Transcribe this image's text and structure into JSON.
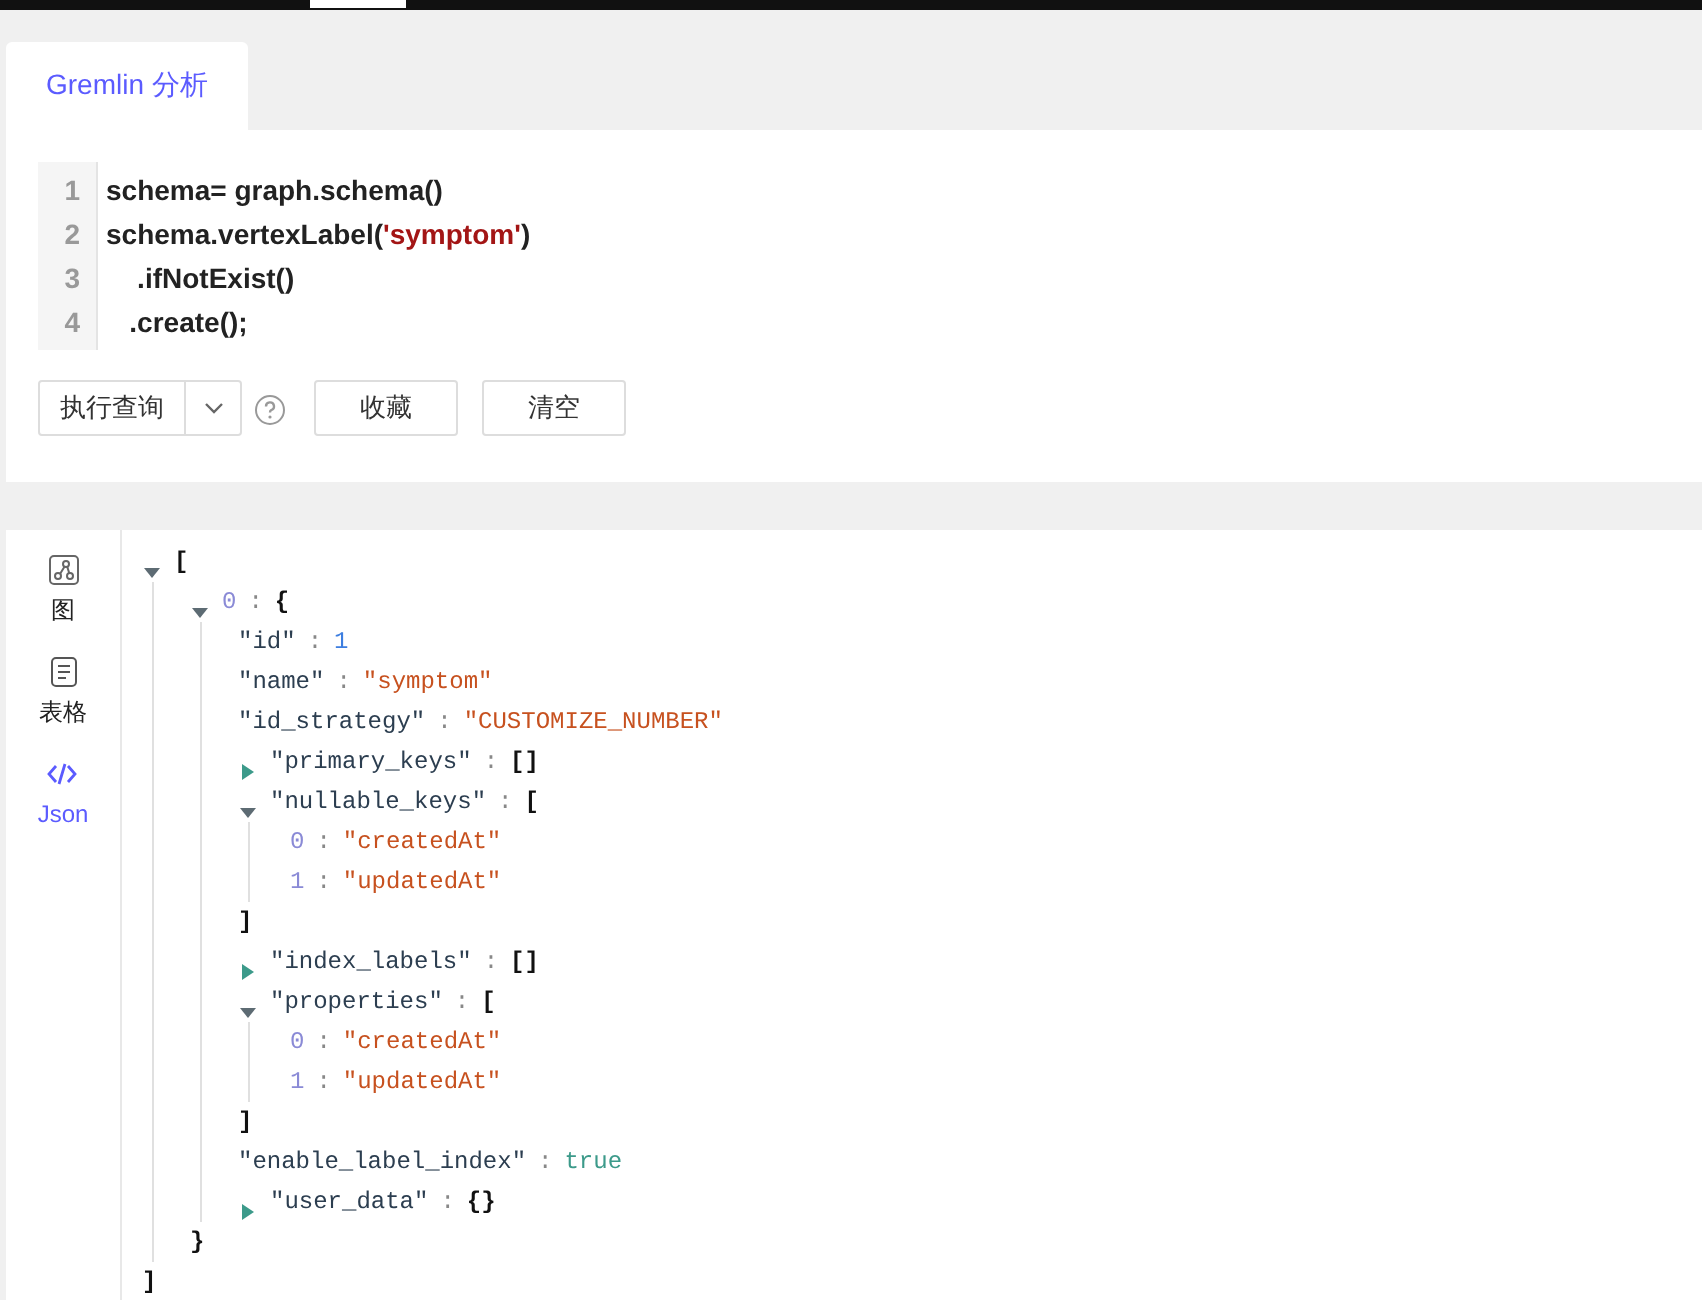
{
  "tabs": [
    {
      "label": "Gremlin 分析",
      "selected": true
    }
  ],
  "editor": {
    "lines": [
      {
        "number": "1",
        "tokens": [
          {
            "kind": "plain",
            "text": "schema= graph.schema()"
          }
        ]
      },
      {
        "number": "2",
        "tokens": [
          {
            "kind": "plain",
            "text": "schema.vertexLabel("
          },
          {
            "kind": "string",
            "text": "'symptom'"
          },
          {
            "kind": "plain",
            "text": ")"
          }
        ]
      },
      {
        "number": "3",
        "tokens": [
          {
            "kind": "plain",
            "text": "    .ifNotExist()"
          }
        ]
      },
      {
        "number": "4",
        "tokens": [
          {
            "kind": "plain",
            "text": "   .create();"
          }
        ]
      }
    ]
  },
  "actions": {
    "run_button": "执行查询",
    "buttons": [
      "收藏",
      "清空"
    ]
  },
  "sidebar": {
    "items": [
      {
        "kind": "graph",
        "label": "图",
        "selected": false
      },
      {
        "kind": "table",
        "label": "表格",
        "selected": false
      },
      {
        "kind": "code",
        "label": "Json",
        "selected": true
      }
    ]
  },
  "json_view": {
    "kind": "array",
    "open": "[",
    "close": "]",
    "expanded": true,
    "children": [
      {
        "kind": "object",
        "key": "0",
        "sep": ":",
        "open": "{",
        "close": "}",
        "expanded": true,
        "children": [
          {
            "kind": "number",
            "key": "\"id\"",
            "sep": ":",
            "value": "1"
          },
          {
            "kind": "string",
            "key": "\"name\"",
            "sep": ":",
            "value": "\"symptom\""
          },
          {
            "kind": "string",
            "key": "\"id_strategy\"",
            "sep": ":",
            "value": "\"CUSTOMIZE_NUMBER\""
          },
          {
            "kind": "array",
            "key": "\"primary_keys\"",
            "sep": ":",
            "value": "[]",
            "expanded": false
          },
          {
            "kind": "array",
            "key": "\"nullable_keys\"",
            "sep": ":",
            "open": "[",
            "close": "]",
            "expanded": true,
            "children": [
              {
                "kind": "string",
                "key": "0",
                "sep": ":",
                "value": "\"createdAt\""
              },
              {
                "kind": "string",
                "key": "1",
                "sep": ":",
                "value": "\"updatedAt\""
              }
            ]
          },
          {
            "kind": "array",
            "key": "\"index_labels\"",
            "sep": ":",
            "value": "[]",
            "expanded": false
          },
          {
            "kind": "array",
            "key": "\"properties\"",
            "sep": ":",
            "open": "[",
            "close": "]",
            "expanded": true,
            "children": [
              {
                "kind": "string",
                "key": "0",
                "sep": ":",
                "value": "\"createdAt\""
              },
              {
                "kind": "string",
                "key": "1",
                "sep": ":",
                "value": "\"updatedAt\""
              }
            ]
          },
          {
            "kind": "boolean",
            "key": "\"enable_label_index\"",
            "sep": ":",
            "value": "true"
          },
          {
            "kind": "object",
            "key": "\"user_data\"",
            "sep": ":",
            "value": "{}",
            "expanded": false
          }
        ]
      }
    ]
  }
}
